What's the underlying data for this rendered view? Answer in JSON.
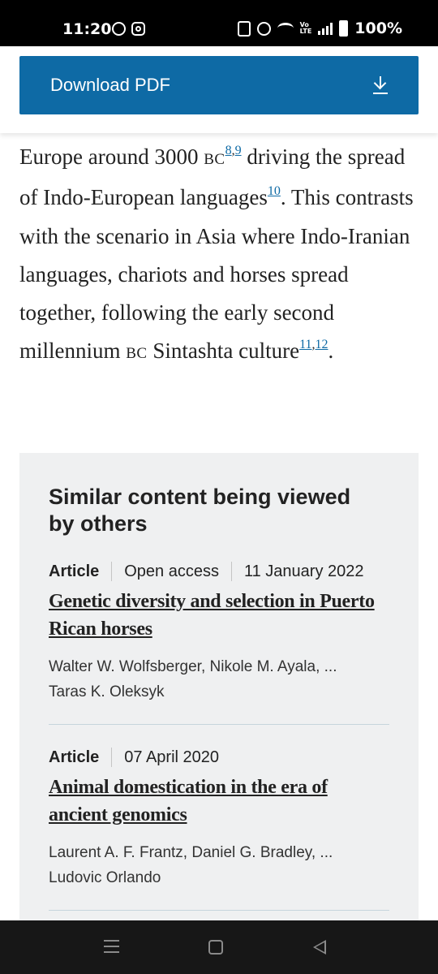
{
  "status_bar": {
    "time": "11:20",
    "battery": "100%",
    "network_label_top": "Vo",
    "network_label_bottom": "LTE",
    "left_icons": [
      "whatsapp-icon",
      "instagram-icon"
    ],
    "right_icons": [
      "nfc-icon",
      "alarm-icon",
      "wifi-icon",
      "volte-icon",
      "signal-icon",
      "battery-icon"
    ]
  },
  "download": {
    "label": "Download PDF",
    "icon": "download-icon"
  },
  "article": {
    "p1": "Europe around 3000 ",
    "bc1": "BC",
    "ref_8": "8",
    "comma1": ",",
    "ref_9": "9",
    "p2": " driving the spread of Indo-European languages",
    "ref_10": "10",
    "p3": ". This contrasts with the scenario in Asia where Indo-Iranian languages, chariots and horses spread together, following the early second millennium ",
    "bc2": "BC",
    "p4": " Sintashta culture",
    "ref_11": "11",
    "comma2": ",",
    "ref_12": "12",
    "p5": "."
  },
  "similar": {
    "heading": "Similar content being viewed by others",
    "items": [
      {
        "type": "Article",
        "access": "Open access",
        "date": "11 January 2022",
        "title": "Genetic diversity and selection in Puerto Rican horses",
        "authors_line1": "Walter W. Wolfsberger, Nikole M. Ayala, ...",
        "authors_line2": "Taras K. Oleksyk"
      },
      {
        "type": "Article",
        "date": "07 April 2020",
        "title": "Animal domestication in the era of ancient genomics",
        "authors_line1": "Laurent A. F. Frantz, Daniel G. Bradley, ...",
        "authors_line2": "Ludovic Orlando"
      }
    ]
  },
  "nav_bar": {
    "buttons": [
      "recent-apps-icon",
      "home-icon",
      "back-icon"
    ]
  },
  "colors": {
    "accent": "#0e6aa5",
    "card_bg": "#eff0f1",
    "text": "#222222"
  }
}
